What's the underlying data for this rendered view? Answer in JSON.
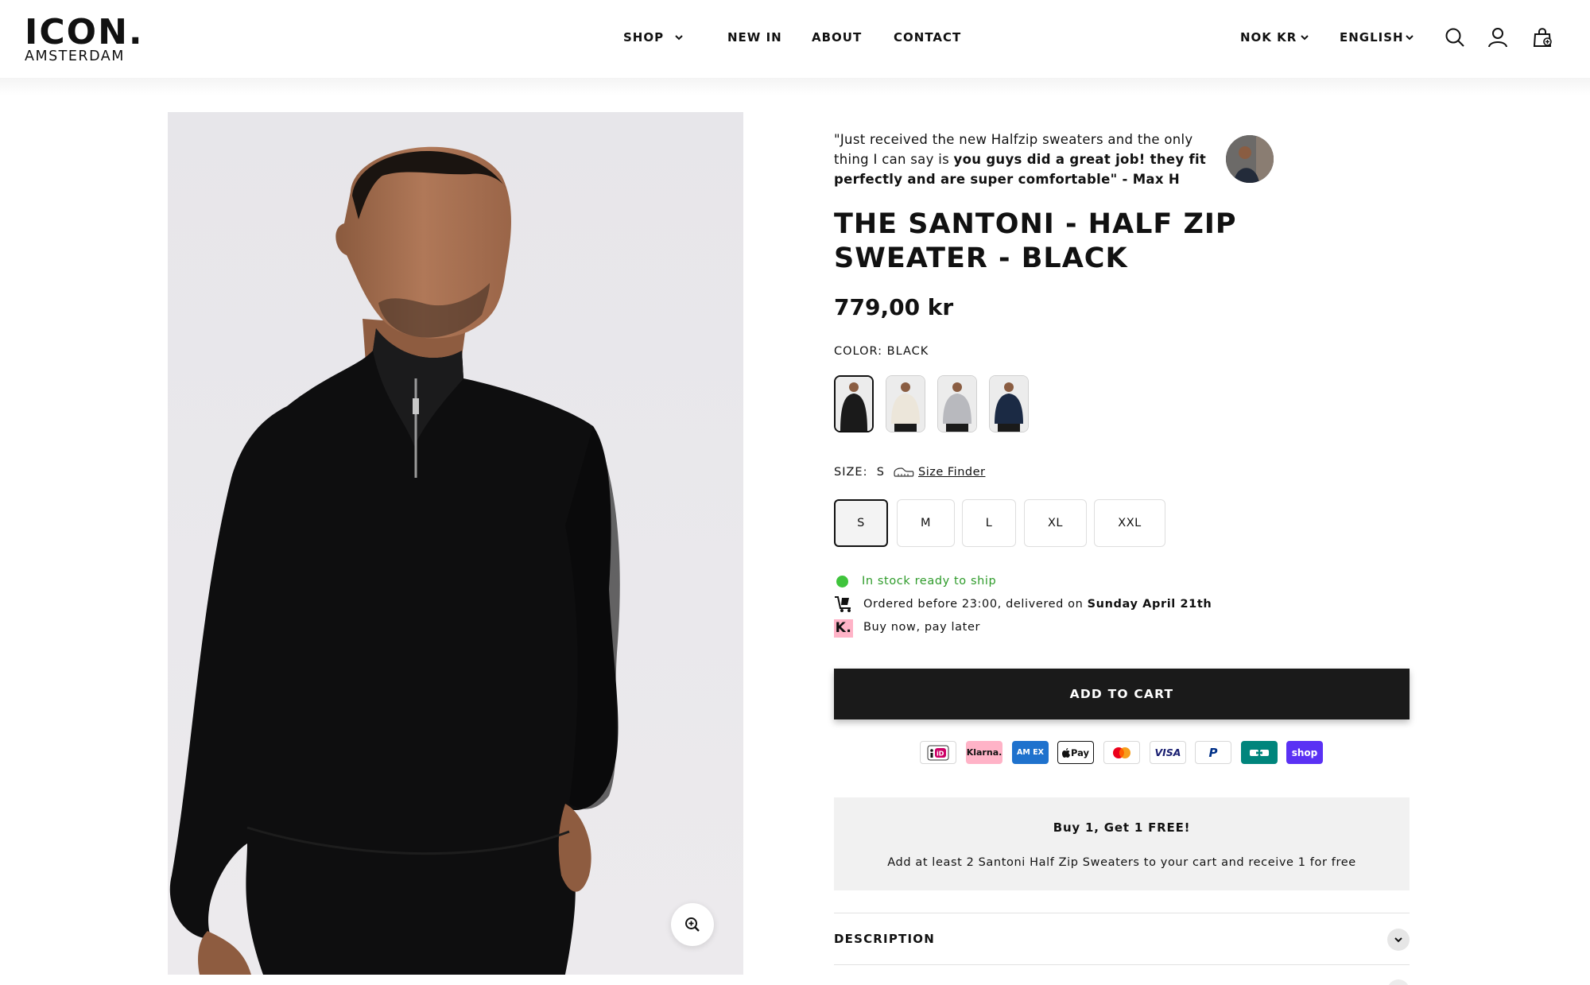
{
  "header": {
    "logo": {
      "main": "ICON.",
      "sub": "AMSTERDAM"
    },
    "nav": [
      {
        "label": "SHOP",
        "has_dropdown": true
      },
      {
        "label": "NEW IN"
      },
      {
        "label": "ABOUT"
      },
      {
        "label": "CONTACT"
      }
    ],
    "currency": "NOK KR",
    "language": "ENGLISH",
    "icons": [
      "search-icon",
      "account-icon",
      "cart-icon"
    ]
  },
  "review": {
    "text_plain": "\"Just received the new Halfzip sweaters and the only thing I can say is ",
    "text_bold": "you guys did a great job! they fit perfectly and are super comfortable\" - Max H"
  },
  "product": {
    "title": "THE SANTONI - HALF ZIP SWEATER - BLACK",
    "price": "779,00 kr",
    "color_label": "COLOR:",
    "color_value": "BLACK",
    "swatches": [
      {
        "name": "black",
        "sweater_color": "#1a1a1a",
        "selected": true
      },
      {
        "name": "cream",
        "sweater_color": "#ece6da",
        "selected": false
      },
      {
        "name": "grey",
        "sweater_color": "#b8b9be",
        "selected": false
      },
      {
        "name": "navy",
        "sweater_color": "#1b2a44",
        "selected": false
      }
    ],
    "size_label": "SIZE:",
    "size_value": "S",
    "size_finder": "Size Finder",
    "sizes": [
      {
        "label": "S",
        "selected": true
      },
      {
        "label": "M",
        "selected": false
      },
      {
        "label": "L",
        "selected": false
      },
      {
        "label": "XL",
        "selected": false
      },
      {
        "label": "XXL",
        "selected": false
      }
    ]
  },
  "availability": {
    "stock": "In stock ready to ship",
    "stock_color": "#2e9b2a",
    "delivery_plain": "Ordered before 23:00, delivered on ",
    "delivery_bold": "Sunday April 21th",
    "klarna_text": "Buy now, pay later"
  },
  "cart": {
    "add_to_cart": "ADD TO CART"
  },
  "payment_methods": [
    {
      "name": "ideal",
      "label": "iD"
    },
    {
      "name": "klarna",
      "label": "Klarna."
    },
    {
      "name": "amex",
      "label": "AM EX"
    },
    {
      "name": "apple-pay",
      "label": "Pay"
    },
    {
      "name": "mastercard",
      "label": ""
    },
    {
      "name": "visa",
      "label": "VISA"
    },
    {
      "name": "paypal",
      "label": "P"
    },
    {
      "name": "bancontact",
      "label": ""
    },
    {
      "name": "shop-pay",
      "label": "shop"
    }
  ],
  "promo": {
    "title": "Buy 1, Get 1 FREE!",
    "text": "Add at least 2 Santoni Half Zip Sweaters to your cart and receive 1 for free"
  },
  "accordion": {
    "description": "DESCRIPTION"
  },
  "colors": {
    "accent": "#1a1a1a",
    "klarna_pink": "#ffb3c7",
    "stock_green": "#3fc43c"
  }
}
